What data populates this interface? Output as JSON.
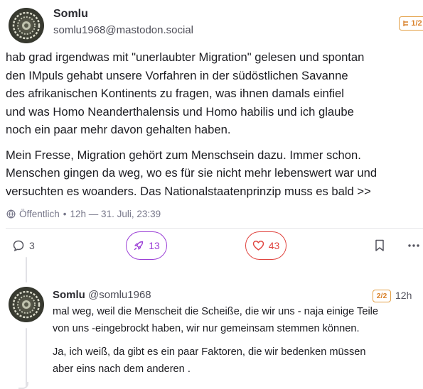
{
  "post": {
    "author_name": "Somlu",
    "author_handle": "somlu1968@mastodon.social",
    "thread_position": "1/2",
    "paragraphs": [
      [
        "hab grad irgendwas mit \"unerlaubter Migration\" gelesen und spontan",
        "den IMpuls gehabt unsere Vorfahren in der südöstlichen Savanne",
        "des afrikanischen Kontinents  zu fragen, was ihnen damals einfiel",
        "und was Homo Neanderthalensis und Homo habilis und ich glaube",
        "noch ein paar mehr davon gehalten haben."
      ],
      [
        "Mein Fresse, Migration gehört zum Menschsein dazu. Immer schon.",
        "Menschen gingen da weg, wo es für sie nicht mehr lebenswert war und",
        "versuchten es woanders. Das Nationalstaatenprinzip muss es bald >>"
      ]
    ],
    "visibility": "Öffentlich",
    "timestamp": "12h — 31. Juli, 23:39",
    "actions": {
      "replies": "3",
      "boosts": "13",
      "favourites": "43"
    },
    "colors": {
      "boost": "#9b3fd6",
      "favourite": "#e0443f",
      "badge": "#e3a046"
    }
  },
  "reply": {
    "author_name": "Somlu",
    "author_handle": "@somlu1968",
    "thread_position": "2/2",
    "time": "12h",
    "paragraphs": [
      [
        "mal weg, weil die Menscheit die Scheiße, die wir uns - naja einige Teile",
        "von uns -eingebrockt haben, wir nur gemeinsam stemmen können."
      ],
      [
        "Ja, ich weiß, da gibt es ein paar Faktoren, die wir bedenken müssen",
        "aber eins nach dem anderen ."
      ]
    ]
  }
}
